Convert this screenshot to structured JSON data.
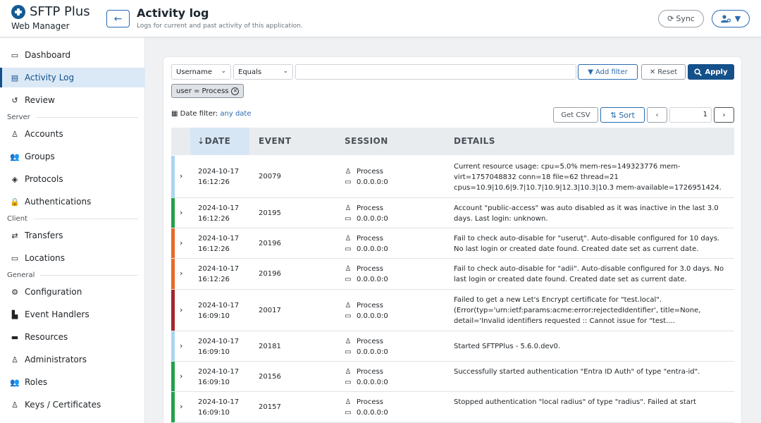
{
  "header": {
    "brand_name": "SFTP Plus",
    "brand_sub": "Web Manager",
    "title": "Activity log",
    "subtitle": "Logs for current and past activity of this application.",
    "sync_label": "Sync"
  },
  "sidebar": {
    "items": [
      {
        "label": "Dashboard",
        "icon": "laptop-icon"
      },
      {
        "label": "Activity Log",
        "icon": "clipboard-icon"
      },
      {
        "label": "Review",
        "icon": "history-icon"
      },
      {
        "label": "Accounts",
        "icon": "user-icon"
      },
      {
        "label": "Groups",
        "icon": "users-icon"
      },
      {
        "label": "Protocols",
        "icon": "layers-icon"
      },
      {
        "label": "Authentications",
        "icon": "lock-icon"
      },
      {
        "label": "Transfers",
        "icon": "exchange-icon"
      },
      {
        "label": "Locations",
        "icon": "monitor-icon"
      },
      {
        "label": "Configuration",
        "icon": "cogs-icon"
      },
      {
        "label": "Event Handlers",
        "icon": "chart-icon"
      },
      {
        "label": "Resources",
        "icon": "archive-icon"
      },
      {
        "label": "Administrators",
        "icon": "user-cog-icon"
      },
      {
        "label": "Roles",
        "icon": "users-cog-icon"
      },
      {
        "label": "Keys / Certificates",
        "icon": "user-key-icon"
      }
    ],
    "sections": {
      "server": "Server",
      "client": "Client",
      "general": "General"
    }
  },
  "filter": {
    "field_value": "Username",
    "operator_value": "Equals",
    "text_value": "",
    "add_filter_label": "Add filter",
    "reset_label": "Reset",
    "apply_label": "Apply",
    "active_chip": "user = Process",
    "date_filter_label": "Date filter:",
    "date_filter_value": "any date",
    "csv_label": "Get CSV",
    "sort_label": "Sort",
    "page_number": "1"
  },
  "table": {
    "columns": [
      "DATE",
      "EVENT",
      "SESSION",
      "DETAILS"
    ],
    "rows": [
      {
        "date": "2024-10-17",
        "time": "16:12:26",
        "event": "20079",
        "user": "Process",
        "address": "0.0.0.0:0",
        "details": "Current resource usage: cpu=5.0% mem-res=149323776 mem-virt=1757048832 conn=18 file=62 thread=21 cpus=10.9|10.6|9.7|10.7|10.9|12.3|10.3|10.3 mem-available=1726951424.",
        "level_color": "#a9d6ef"
      },
      {
        "date": "2024-10-17",
        "time": "16:12:26",
        "event": "20195",
        "user": "Process",
        "address": "0.0.0.0:0",
        "details": "Account \"public-access\" was auto disabled as it was inactive in the last 3.0 days. Last login: unknown.",
        "level_color": "#23a14a"
      },
      {
        "date": "2024-10-17",
        "time": "16:12:26",
        "event": "20196",
        "user": "Process",
        "address": "0.0.0.0:0",
        "details": "Fail to check auto-disable for \"useruţ\". Auto-disable configured for 10 days. No last login or created date found. Created date set as current date.",
        "level_color": "#e8692a"
      },
      {
        "date": "2024-10-17",
        "time": "16:12:26",
        "event": "20196",
        "user": "Process",
        "address": "0.0.0.0:0",
        "details": "Fail to check auto-disable for \"adii\". Auto-disable configured for 3.0 days. No last login or created date found. Created date set as current date.",
        "level_color": "#e8692a"
      },
      {
        "date": "2024-10-17",
        "time": "16:09:10",
        "event": "20017",
        "user": "Process",
        "address": "0.0.0.0:0",
        "details": "Failed to get a new Let's Encrypt certificate for \"test.local\". (Error(typ='urn:ietf:params:acme:error:rejectedIdentifier', title=None, detail='Invalid identifiers requested :: Cannot issue for \"test....",
        "level_color": "#a7262b"
      },
      {
        "date": "2024-10-17",
        "time": "16:09:10",
        "event": "20181",
        "user": "Process",
        "address": "0.0.0.0:0",
        "details": "Started SFTPPlus - 5.6.0.dev0.",
        "level_color": "#a9d6ef"
      },
      {
        "date": "2024-10-17",
        "time": "16:09:10",
        "event": "20156",
        "user": "Process",
        "address": "0.0.0.0:0",
        "details": "Successfully started authentication \"Entra ID Auth\" of type \"entra-id\".",
        "level_color": "#23a14a"
      },
      {
        "date": "2024-10-17",
        "time": "16:09:10",
        "event": "20157",
        "user": "Process",
        "address": "0.0.0.0:0",
        "details": "Stopped authentication \"local radius\" of type \"radius\". Failed at start",
        "level_color": "#23a14a"
      }
    ]
  },
  "colors": {
    "accent": "#14508a",
    "active_nav_bg": "#dbe9f7"
  }
}
